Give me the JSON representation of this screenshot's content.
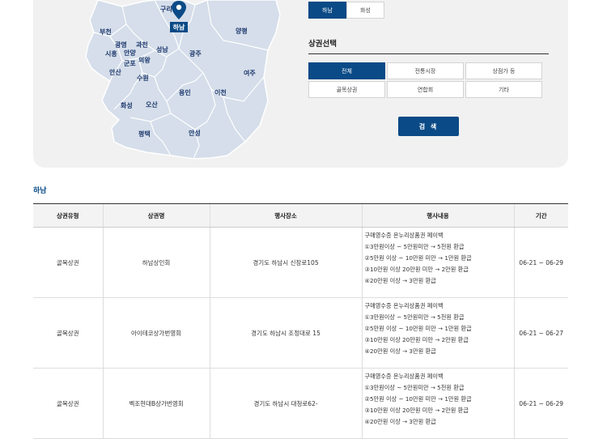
{
  "map": {
    "labels": {
      "guri": "구리",
      "hanam": "하남",
      "yangpyeong": "양평",
      "bucheon": "부천",
      "gwangmyeong": "광명",
      "gwacheon": "과천",
      "siheung": "시흥",
      "anyang": "안양",
      "seongnam": "성남",
      "gwangju": "광주",
      "gunpo": "군포",
      "uiwang": "의왕",
      "ansan": "안산",
      "suwon": "수원",
      "yeoju": "여주",
      "yongin": "용인",
      "icheon": "이천",
      "hwaseong": "화성",
      "osan": "오산",
      "pyeongtaek": "평택",
      "anseong": "안성"
    },
    "selected_marker_icon": "map-pin-icon"
  },
  "region_tabs": [
    {
      "label": "하남",
      "active": true
    },
    {
      "label": "화성",
      "active": false
    }
  ],
  "category": {
    "title": "상권선택",
    "buttons": [
      {
        "label": "전체",
        "active": true
      },
      {
        "label": "전통시장",
        "active": false
      },
      {
        "label": "상점가 등",
        "active": false
      },
      {
        "label": "골목상권",
        "active": false
      },
      {
        "label": "연합회",
        "active": false
      },
      {
        "label": "기타",
        "active": false
      }
    ]
  },
  "search_button": "검 색",
  "result_region": "하남",
  "table": {
    "headers": [
      "상권유형",
      "상권명",
      "행사장소",
      "행사내용",
      "기간"
    ],
    "rows": [
      {
        "type": "골목상권",
        "name": "하남상인회",
        "place": "경기도 하남시 신장로105",
        "content": [
          "구매영수증 온누리상품권 페이백",
          "①3만원이상 ~ 5만원미만 → 5천원 환급",
          "②5만원 이상 ~ 10만원 미만 → 1만원 환급",
          "③10만원 이상 20만원 미만 → 2만원 환급",
          "④20만원 이상 → 3만원 환급"
        ],
        "period": "06-21 ~ 06-29"
      },
      {
        "type": "골목상권",
        "name": "아이테코상가번영회",
        "place": "경기도 하남시 조정대로 15",
        "content": [
          "구매영수증 온누리상품권 페이백",
          "①3만원이상 ~ 5만원미만 → 5천원 환급",
          "②5만원 이상 ~ 10만원 미만 → 1만원 환급",
          "③10만원 이상 20만원 미만 → 2만원 환급",
          "④20만원 이상 → 3만원 환급"
        ],
        "period": "06-21 ~ 06-27"
      },
      {
        "type": "골목상권",
        "name": "벡조현대B상가번영회",
        "place": "경기도 하남시 대청로62-",
        "content": [
          "구매영수증 온누리상품권 페이백",
          "①3만원이상 ~ 5만원미만 → 5천원 환급",
          "②5만원 이상 ~ 10만원 미만 → 1만원 환급",
          "③10만원 이상 20만원 미만 → 2만원 환급",
          "④20만원 이상 → 3만원 환급"
        ],
        "period": "06-21 ~ 06-29"
      }
    ]
  },
  "colors": {
    "accent": "#0a4a86",
    "map_fill": "#d5deea",
    "map_border": "#ffffff",
    "panel_bg": "#f1f1f1"
  }
}
